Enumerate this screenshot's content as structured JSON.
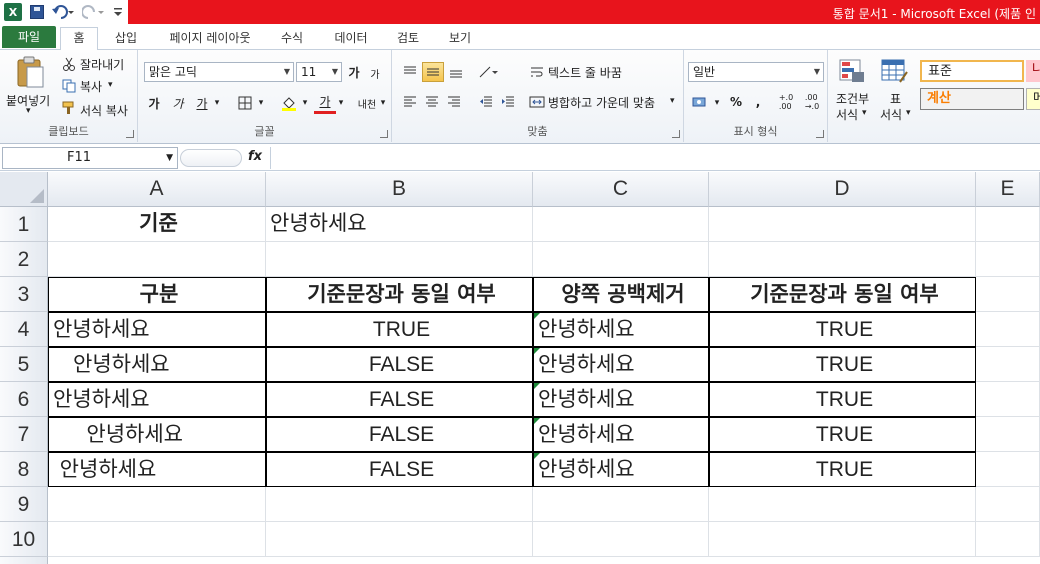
{
  "window": {
    "title": "통합 문서1  -  Microsoft Excel (제품 인"
  },
  "quick_access": {
    "logo_letter": "X"
  },
  "tabs": [
    "파일",
    "홈",
    "삽입",
    "페이지 레이아웃",
    "수식",
    "데이터",
    "검토",
    "보기"
  ],
  "ribbon": {
    "clipboard": {
      "paste": "붙여넣기",
      "cut": "잘라내기",
      "copy": "복사",
      "format_painter": "서식 복사",
      "label": "클립보드"
    },
    "font": {
      "name": "맑은 고딕",
      "size": "11",
      "grow": "가",
      "shrink": "가",
      "bold": "가",
      "italic": "가",
      "underline": "가",
      "font_color_letter": "가",
      "phonetic": "내천",
      "label": "글꼴"
    },
    "alignment": {
      "wrap_text": "텍스트 줄 바꿈",
      "merge_center": "병합하고 가운데 맞춤",
      "label": "맞춤"
    },
    "number": {
      "format": "일반",
      "percent": "%",
      "comma": ",",
      "inc_decimal": "+.0\n.00",
      "dec_decimal": ".00\n→.0",
      "label": "표시 형식"
    },
    "styles": {
      "conditional_1": "조건부",
      "conditional_2": "서식",
      "table_1": "표",
      "table_2": "서식",
      "normal": "표준",
      "calc": "계산",
      "bad": "나",
      "neutral": "메"
    }
  },
  "formula_bar": {
    "name_box": "F11",
    "fx": "fx",
    "content": ""
  },
  "sheet": {
    "columns": [
      "A",
      "B",
      "C",
      "D",
      "E"
    ],
    "rows": [
      "1",
      "2",
      "3",
      "4",
      "5",
      "6",
      "7",
      "8",
      "9",
      "10"
    ],
    "criteria_label": "기준",
    "criteria_value": "안녕하세요",
    "headers": [
      "구분",
      "기준문장과 동일 여부",
      "양쪽 공백제거",
      "기준문장과 동일 여부"
    ],
    "data": [
      {
        "a": "안녕하세요",
        "b": "TRUE",
        "c": "안녕하세요",
        "d": "TRUE"
      },
      {
        "a": "   안녕하세요",
        "b": "FALSE",
        "c": "안녕하세요",
        "d": "TRUE"
      },
      {
        "a": "안녕하세요  ",
        "b": "FALSE",
        "c": "안녕하세요",
        "d": "TRUE"
      },
      {
        "a": "     안녕하세요",
        "b": "FALSE",
        "c": "안녕하세요",
        "d": "TRUE"
      },
      {
        "a": " 안녕하세요  ",
        "b": "FALSE",
        "c": "안녕하세요",
        "d": "TRUE"
      }
    ]
  }
}
